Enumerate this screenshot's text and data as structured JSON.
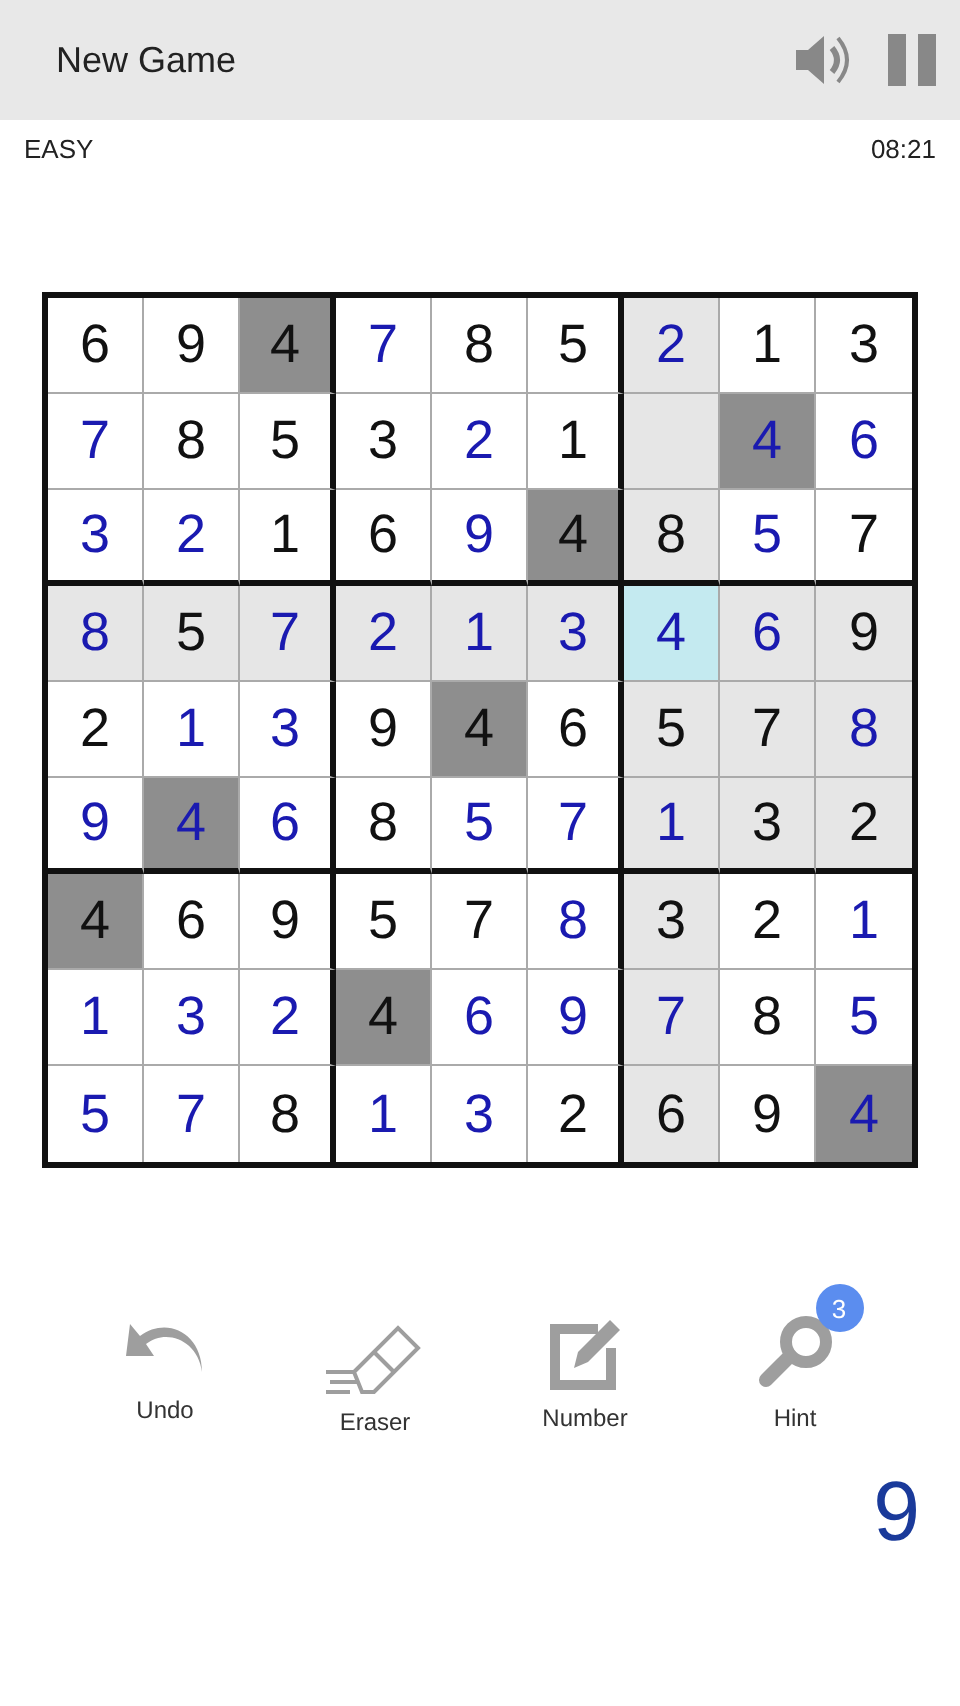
{
  "header": {
    "title": "New Game"
  },
  "status": {
    "difficulty": "EASY",
    "time": "08:21"
  },
  "grid": {
    "rows": [
      [
        {
          "value": "6",
          "kind": "given",
          "highlighted": false,
          "same_number": false,
          "selected": false
        },
        {
          "value": "9",
          "kind": "given",
          "highlighted": false,
          "same_number": false,
          "selected": false
        },
        {
          "value": "4",
          "kind": "given",
          "highlighted": false,
          "same_number": true,
          "selected": false
        },
        {
          "value": "7",
          "kind": "entered",
          "highlighted": false,
          "same_number": false,
          "selected": false
        },
        {
          "value": "8",
          "kind": "given",
          "highlighted": false,
          "same_number": false,
          "selected": false
        },
        {
          "value": "5",
          "kind": "given",
          "highlighted": false,
          "same_number": false,
          "selected": false
        },
        {
          "value": "2",
          "kind": "entered",
          "highlighted": true,
          "same_number": false,
          "selected": false
        },
        {
          "value": "1",
          "kind": "given",
          "highlighted": false,
          "same_number": false,
          "selected": false
        },
        {
          "value": "3",
          "kind": "given",
          "highlighted": false,
          "same_number": false,
          "selected": false
        }
      ],
      [
        {
          "value": "7",
          "kind": "entered",
          "highlighted": false,
          "same_number": false,
          "selected": false
        },
        {
          "value": "8",
          "kind": "given",
          "highlighted": false,
          "same_number": false,
          "selected": false
        },
        {
          "value": "5",
          "kind": "given",
          "highlighted": false,
          "same_number": false,
          "selected": false
        },
        {
          "value": "3",
          "kind": "given",
          "highlighted": false,
          "same_number": false,
          "selected": false
        },
        {
          "value": "2",
          "kind": "entered",
          "highlighted": false,
          "same_number": false,
          "selected": false
        },
        {
          "value": "1",
          "kind": "given",
          "highlighted": false,
          "same_number": false,
          "selected": false
        },
        {
          "highlighted": true,
          "same_number": false,
          "selected": false
        },
        {
          "value": "4",
          "kind": "entered",
          "highlighted": false,
          "same_number": true,
          "selected": false
        },
        {
          "value": "6",
          "kind": "entered",
          "highlighted": false,
          "same_number": false,
          "selected": false
        }
      ],
      [
        {
          "value": "3",
          "kind": "entered",
          "highlighted": false,
          "same_number": false,
          "selected": false
        },
        {
          "value": "2",
          "kind": "entered",
          "highlighted": false,
          "same_number": false,
          "selected": false
        },
        {
          "value": "1",
          "kind": "given",
          "highlighted": false,
          "same_number": false,
          "selected": false
        },
        {
          "value": "6",
          "kind": "given",
          "highlighted": false,
          "same_number": false,
          "selected": false
        },
        {
          "value": "9",
          "kind": "entered",
          "highlighted": false,
          "same_number": false,
          "selected": false
        },
        {
          "value": "4",
          "kind": "given",
          "highlighted": false,
          "same_number": true,
          "selected": false
        },
        {
          "value": "8",
          "kind": "given",
          "highlighted": true,
          "same_number": false,
          "selected": false
        },
        {
          "value": "5",
          "kind": "entered",
          "highlighted": false,
          "same_number": false,
          "selected": false
        },
        {
          "value": "7",
          "kind": "given",
          "highlighted": false,
          "same_number": false,
          "selected": false
        }
      ],
      [
        {
          "value": "8",
          "kind": "entered",
          "highlighted": true,
          "same_number": false,
          "selected": false
        },
        {
          "value": "5",
          "kind": "given",
          "highlighted": true,
          "same_number": false,
          "selected": false
        },
        {
          "value": "7",
          "kind": "entered",
          "highlighted": true,
          "same_number": false,
          "selected": false
        },
        {
          "value": "2",
          "kind": "entered",
          "highlighted": true,
          "same_number": false,
          "selected": false
        },
        {
          "value": "1",
          "kind": "entered",
          "highlighted": true,
          "same_number": false,
          "selected": false
        },
        {
          "value": "3",
          "kind": "entered",
          "highlighted": true,
          "same_number": false,
          "selected": false
        },
        {
          "value": "4",
          "kind": "entered",
          "highlighted": false,
          "same_number": false,
          "selected": true
        },
        {
          "value": "6",
          "kind": "entered",
          "highlighted": true,
          "same_number": false,
          "selected": false
        },
        {
          "value": "9",
          "kind": "given",
          "highlighted": true,
          "same_number": false,
          "selected": false
        }
      ],
      [
        {
          "value": "2",
          "kind": "given",
          "highlighted": false,
          "same_number": false,
          "selected": false
        },
        {
          "value": "1",
          "kind": "entered",
          "highlighted": false,
          "same_number": false,
          "selected": false
        },
        {
          "value": "3",
          "kind": "entered",
          "highlighted": false,
          "same_number": false,
          "selected": false
        },
        {
          "value": "9",
          "kind": "given",
          "highlighted": false,
          "same_number": false,
          "selected": false
        },
        {
          "value": "4",
          "kind": "given",
          "highlighted": false,
          "same_number": true,
          "selected": false
        },
        {
          "value": "6",
          "kind": "given",
          "highlighted": false,
          "same_number": false,
          "selected": false
        },
        {
          "value": "5",
          "kind": "given",
          "highlighted": true,
          "same_number": false,
          "selected": false
        },
        {
          "value": "7",
          "kind": "given",
          "highlighted": true,
          "same_number": false,
          "selected": false
        },
        {
          "value": "8",
          "kind": "entered",
          "highlighted": true,
          "same_number": false,
          "selected": false
        }
      ],
      [
        {
          "value": "9",
          "kind": "entered",
          "highlighted": false,
          "same_number": false,
          "selected": false
        },
        {
          "value": "4",
          "kind": "entered",
          "highlighted": false,
          "same_number": true,
          "selected": false
        },
        {
          "value": "6",
          "kind": "entered",
          "highlighted": false,
          "same_number": false,
          "selected": false
        },
        {
          "value": "8",
          "kind": "given",
          "highlighted": false,
          "same_number": false,
          "selected": false
        },
        {
          "value": "5",
          "kind": "entered",
          "highlighted": false,
          "same_number": false,
          "selected": false
        },
        {
          "value": "7",
          "kind": "entered",
          "highlighted": false,
          "same_number": false,
          "selected": false
        },
        {
          "value": "1",
          "kind": "entered",
          "highlighted": true,
          "same_number": false,
          "selected": false
        },
        {
          "value": "3",
          "kind": "given",
          "highlighted": true,
          "same_number": false,
          "selected": false
        },
        {
          "value": "2",
          "kind": "given",
          "highlighted": true,
          "same_number": false,
          "selected": false
        }
      ],
      [
        {
          "value": "4",
          "kind": "given",
          "highlighted": false,
          "same_number": true,
          "selected": false
        },
        {
          "value": "6",
          "kind": "given",
          "highlighted": false,
          "same_number": false,
          "selected": false
        },
        {
          "value": "9",
          "kind": "given",
          "highlighted": false,
          "same_number": false,
          "selected": false
        },
        {
          "value": "5",
          "kind": "given",
          "highlighted": false,
          "same_number": false,
          "selected": false
        },
        {
          "value": "7",
          "kind": "given",
          "highlighted": false,
          "same_number": false,
          "selected": false
        },
        {
          "value": "8",
          "kind": "entered",
          "highlighted": false,
          "same_number": false,
          "selected": false
        },
        {
          "value": "3",
          "kind": "given",
          "highlighted": true,
          "same_number": false,
          "selected": false
        },
        {
          "value": "2",
          "kind": "given",
          "highlighted": false,
          "same_number": false,
          "selected": false
        },
        {
          "value": "1",
          "kind": "entered",
          "highlighted": false,
          "same_number": false,
          "selected": false
        }
      ],
      [
        {
          "value": "1",
          "kind": "entered",
          "highlighted": false,
          "same_number": false,
          "selected": false
        },
        {
          "value": "3",
          "kind": "entered",
          "highlighted": false,
          "same_number": false,
          "selected": false
        },
        {
          "value": "2",
          "kind": "entered",
          "highlighted": false,
          "same_number": false,
          "selected": false
        },
        {
          "value": "4",
          "kind": "given",
          "highlighted": false,
          "same_number": true,
          "selected": false
        },
        {
          "value": "6",
          "kind": "entered",
          "highlighted": false,
          "same_number": false,
          "selected": false
        },
        {
          "value": "9",
          "kind": "entered",
          "highlighted": false,
          "same_number": false,
          "selected": false
        },
        {
          "value": "7",
          "kind": "entered",
          "highlighted": true,
          "same_number": false,
          "selected": false
        },
        {
          "value": "8",
          "kind": "given",
          "highlighted": false,
          "same_number": false,
          "selected": false
        },
        {
          "value": "5",
          "kind": "entered",
          "highlighted": false,
          "same_number": false,
          "selected": false
        }
      ],
      [
        {
          "value": "5",
          "kind": "entered",
          "highlighted": false,
          "same_number": false,
          "selected": false
        },
        {
          "value": "7",
          "kind": "entered",
          "highlighted": false,
          "same_number": false,
          "selected": false
        },
        {
          "value": "8",
          "kind": "given",
          "highlighted": false,
          "same_number": false,
          "selected": false
        },
        {
          "value": "1",
          "kind": "entered",
          "highlighted": false,
          "same_number": false,
          "selected": false
        },
        {
          "value": "3",
          "kind": "entered",
          "highlighted": false,
          "same_number": false,
          "selected": false
        },
        {
          "value": "2",
          "kind": "given",
          "highlighted": false,
          "same_number": false,
          "selected": false
        },
        {
          "value": "6",
          "kind": "given",
          "highlighted": true,
          "same_number": false,
          "selected": false
        },
        {
          "value": "9",
          "kind": "given",
          "highlighted": false,
          "same_number": false,
          "selected": false
        },
        {
          "value": "4",
          "kind": "entered",
          "highlighted": false,
          "same_number": true,
          "selected": false
        }
      ]
    ]
  },
  "tools": [
    {
      "kind": "undo",
      "label": "Undo"
    },
    {
      "kind": "eraser",
      "label": "Eraser"
    },
    {
      "kind": "number",
      "label": "Number"
    },
    {
      "kind": "hint",
      "label": "Hint",
      "badge": "3"
    }
  ],
  "current_number": "9"
}
